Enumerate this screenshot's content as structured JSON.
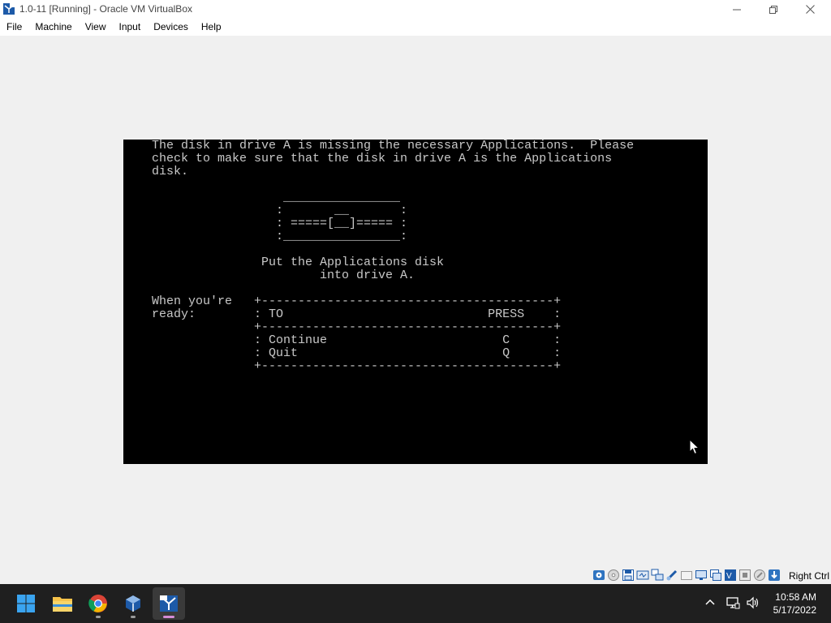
{
  "window": {
    "title": "1.0-11 [Running] - Oracle VM VirtualBox"
  },
  "menu": [
    {
      "label": "File"
    },
    {
      "label": "Machine"
    },
    {
      "label": "View"
    },
    {
      "label": "Input"
    },
    {
      "label": "Devices"
    },
    {
      "label": "Help"
    }
  ],
  "vm_screen": {
    "lines": [
      "The disk in drive A is missing the necessary Applications.  Please",
      "check to make sure that the disk in drive A is the Applications",
      "disk.",
      "",
      "                  ________________",
      "                 :       __       :",
      "                 : =====[__]===== :",
      "                 :________________:",
      "",
      "               Put the Applications disk",
      "                       into drive A.",
      "",
      "When you're   +----------------------------------------+",
      "ready:        : TO                            PRESS    :",
      "              +----------------------------------------+",
      "              : Continue                        C      :",
      "              : Quit                            Q      :",
      "              +----------------------------------------+"
    ]
  },
  "statusbar": {
    "host_key": "Right Ctrl",
    "icons": [
      "hard-disk-icon",
      "optical-drive-icon",
      "floppy-icon",
      "audio-icon",
      "network-icon",
      "usb-icon",
      "shared-folders-icon",
      "display-icon",
      "recording-icon",
      "video-capture-icon",
      "cpu-icon",
      "mouse-integration-icon",
      "keyboard-icon"
    ]
  },
  "taskbar": {
    "apps": [
      {
        "name": "start",
        "icon": "windows-start-icon"
      },
      {
        "name": "file-explorer",
        "icon": "folder-icon"
      },
      {
        "name": "chrome",
        "icon": "chrome-icon"
      },
      {
        "name": "virtualbox-manager",
        "icon": "virtualbox-icon"
      },
      {
        "name": "virtualbox-vm",
        "icon": "virtualbox-vm-icon"
      }
    ],
    "time": "10:58 AM",
    "date": "5/17/2022"
  },
  "colors": {
    "vm_background": "#000000",
    "vm_text": "#c8c8c8",
    "taskbar": "#1f1f1f",
    "active_indicator": "#d58bd6"
  }
}
